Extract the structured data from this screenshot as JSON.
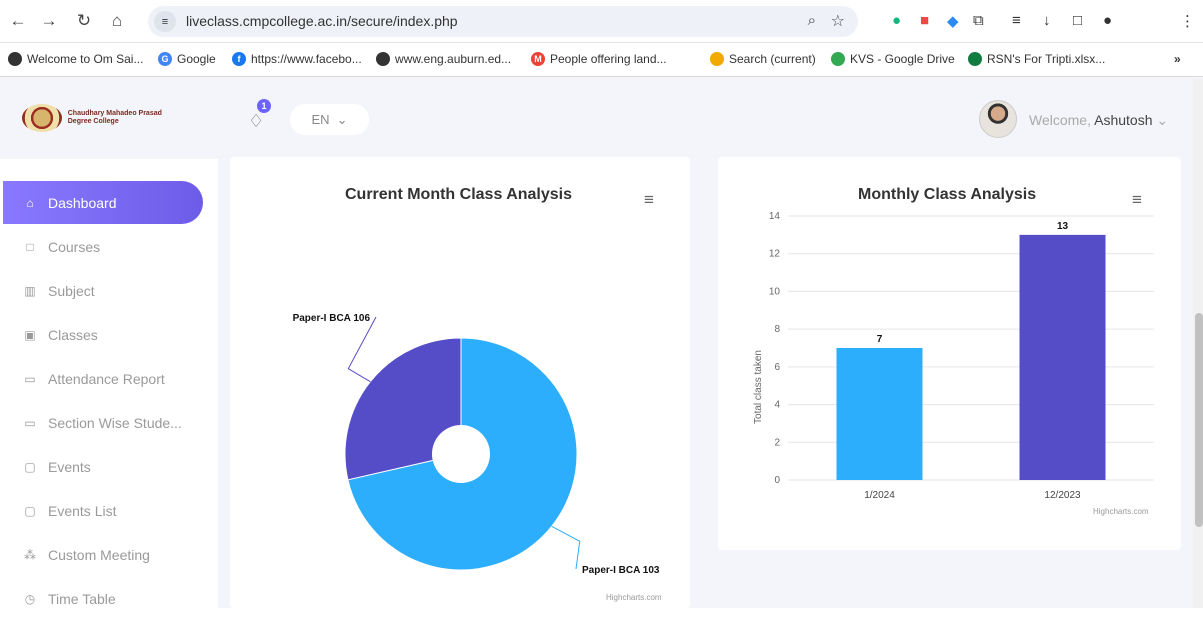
{
  "browser": {
    "url": "liveclass.cmpcollege.ac.in/secure/index.php",
    "bookmarks": [
      "Welcome to Om Sai...",
      "Google",
      "https://www.facebo...",
      "www.eng.auburn.ed...",
      "People offering land...",
      "Search (current)",
      "KVS - Google Drive",
      "RSN's For Tripti.xlsx..."
    ],
    "more": "»"
  },
  "header": {
    "college_name": "Chaudhary Mahadeo Prasad Degree College",
    "notification_count": "1",
    "language": "EN",
    "welcome": "Welcome, ",
    "user": "Ashutosh"
  },
  "sidebar": {
    "items": [
      {
        "label": "Dashboard",
        "icon": "home-icon"
      },
      {
        "label": "Courses",
        "icon": "bookmark-icon"
      },
      {
        "label": "Subject",
        "icon": "book-icon"
      },
      {
        "label": "Classes",
        "icon": "grid-icon"
      },
      {
        "label": "Attendance Report",
        "icon": "monitor-icon"
      },
      {
        "label": "Section Wise Stude...",
        "icon": "monitor-icon"
      },
      {
        "label": "Events",
        "icon": "event-icon"
      },
      {
        "label": "Events List",
        "icon": "event-icon"
      },
      {
        "label": "Custom Meeting",
        "icon": "meeting-icon"
      },
      {
        "label": "Time Table",
        "icon": "clock-icon"
      }
    ]
  },
  "chart_data": [
    {
      "type": "pie",
      "title": "Current Month Class Analysis",
      "labels": [
        "Paper-I BCA 103",
        "Paper-I BCA 106"
      ],
      "values": [
        5,
        2
      ],
      "colors": [
        "#2daefc",
        "#554cc8"
      ],
      "credits": "Highcharts.com"
    },
    {
      "type": "bar",
      "title": "Monthly Class Analysis",
      "categories": [
        "1/2024",
        "12/2023"
      ],
      "values": [
        7,
        13
      ],
      "colors": [
        "#2daefc",
        "#554cc8"
      ],
      "ylabel": "Total class taken",
      "ylim": [
        0,
        14
      ],
      "yticks": [
        0,
        2,
        4,
        6,
        8,
        10,
        12,
        14
      ],
      "credits": "Highcharts.com"
    }
  ]
}
